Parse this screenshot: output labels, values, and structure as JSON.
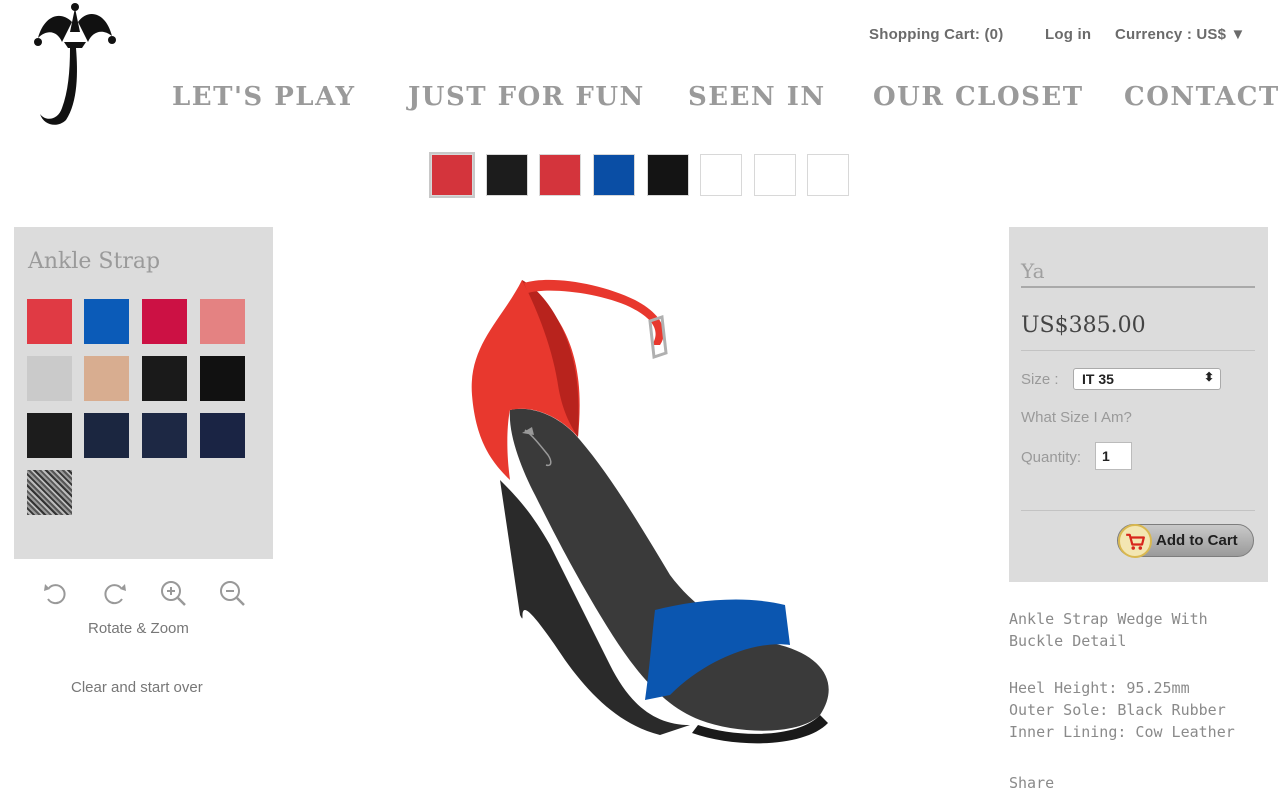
{
  "header": {
    "cart_label": "Shopping Cart: (0)",
    "login_label": "Log in",
    "currency_label": "Currency : US$ ▼"
  },
  "nav": {
    "items": [
      "LET'S PLAY",
      "JUST FOR FUN",
      "SEEN IN",
      "OUR CLOSET",
      "CONTACT"
    ]
  },
  "part_selector": {
    "colors": [
      "#d4343c",
      "#1c1c1c",
      "#d4343c",
      "#0a4ea5",
      "#141414",
      "#ffffff",
      "#ffffff",
      "#ffffff"
    ],
    "selected_index": 0
  },
  "material_panel": {
    "title": "Ankle Strap",
    "swatches": [
      "#e03a44",
      "#0b5bb8",
      "#cc1144",
      "#e48282",
      "#cacaca",
      "#d8ad90",
      "#1a1a1a",
      "#111111",
      "#1c1c1c",
      "#1b2640",
      "#1d2844",
      "#1a2444",
      "pattern-gray"
    ]
  },
  "tools": {
    "rotate_zoom_label": "Rotate & Zoom",
    "clear_label": "Clear and start over",
    "icons": [
      "rotate-left-icon",
      "rotate-right-icon",
      "zoom-in-icon",
      "zoom-out-icon"
    ]
  },
  "product": {
    "name": "Ya",
    "price": "US$385.00",
    "size_label": "Size :",
    "size_value": "IT 35",
    "what_size_label": "What Size I Am?",
    "quantity_label": "Quantity:",
    "quantity_value": "1",
    "add_to_cart_label": "Add to Cart"
  },
  "description": {
    "title_line1": "Ankle Strap Wedge With",
    "title_line2": "Buckle Detail",
    "heel_height": "Heel Height: 95.25mm",
    "outer_sole": "Outer Sole: Black Rubber",
    "inner_lining": "Inner Lining: Cow Leather",
    "share_label": "Share"
  }
}
